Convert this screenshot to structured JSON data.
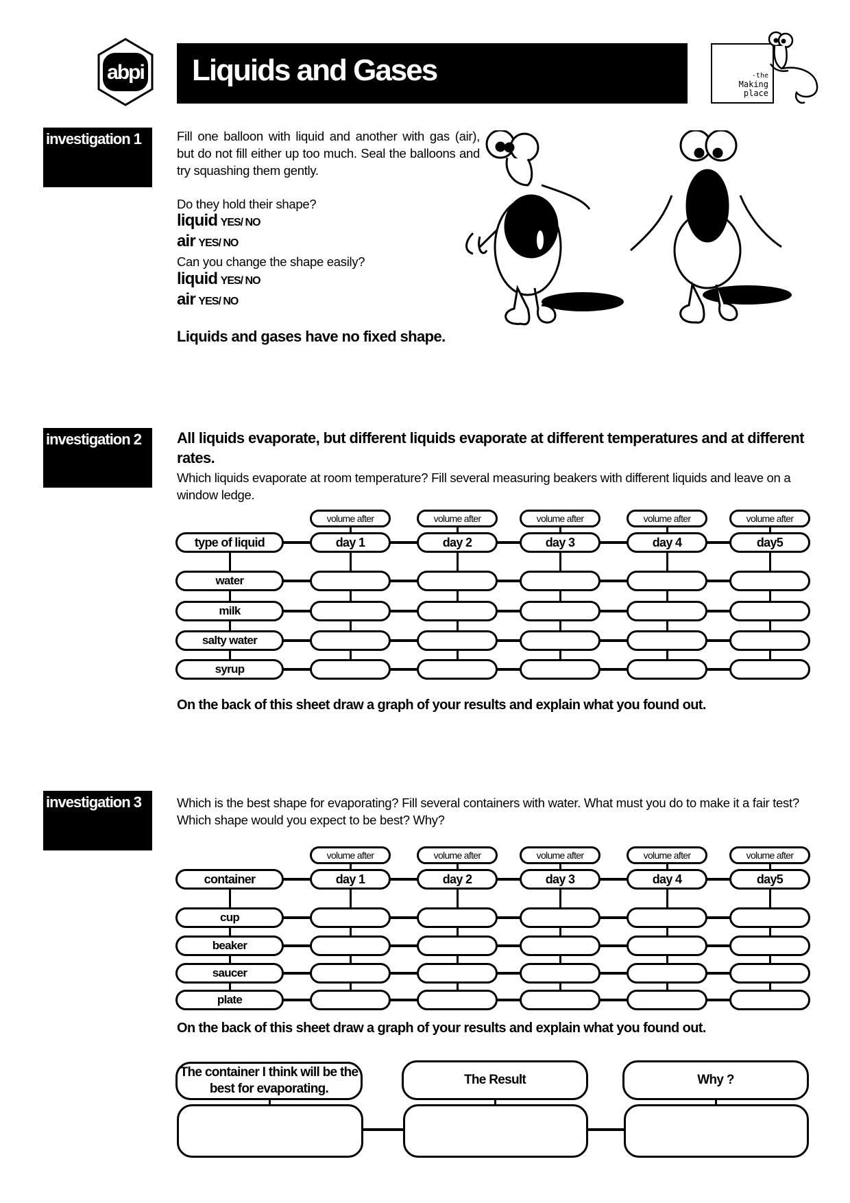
{
  "header": {
    "logo_text": "abpi",
    "title": "Liquids and Gases",
    "partner_logo": {
      "line1": "-the",
      "line2": "Making",
      "line3": "place"
    }
  },
  "investigation1": {
    "label": "investigation 1",
    "intro": "Fill one balloon with liquid and another with gas (air), but do not fill either up too much. Seal the balloons and try squashing them gently.",
    "q1": "Do they hold their shape?",
    "q2": "Can you change the shape easily?",
    "rows": [
      {
        "label": "liquid",
        "choice": "YES/ NO"
      },
      {
        "label": "air",
        "choice": "YES/ NO"
      },
      {
        "label": "liquid",
        "choice": "YES/ NO"
      },
      {
        "label": "air",
        "choice": "YES/ NO"
      }
    ],
    "conclusion": "Liquids and gases have no fixed shape."
  },
  "investigation2": {
    "label": "investigation 2",
    "headline": "All liquids evaporate, but different liquids evaporate at different temperatures and at different rates.",
    "intro": "Which liquids evaporate at room temperature? Fill several measuring beakers with different liquids and leave on a window ledge.",
    "table": {
      "corner": "type of liquid",
      "volume_label": "volume after",
      "days": [
        "day 1",
        "day 2",
        "day 3",
        "day 4",
        "day5"
      ],
      "rows": [
        "water",
        "milk",
        "salty water",
        "syrup"
      ]
    },
    "footer": "On the back of this sheet draw a graph of your results and explain what you found out."
  },
  "investigation3": {
    "label": "investigation 3",
    "intro": "Which is the best shape for evaporating? Fill several containers with water.  What must you do to make it a fair test? Which shape would you expect to be best? Why?",
    "table": {
      "corner": "container",
      "volume_label": "volume after",
      "days": [
        "day 1",
        "day 2",
        "day 3",
        "day 4",
        "day5"
      ],
      "rows": [
        "cup",
        "beaker",
        "saucer",
        "plate"
      ]
    },
    "footer": "On the back of this sheet draw a graph of your results and explain what you found out.",
    "boxes": [
      "The container I think will be the best for evaporating.",
      "The Result",
      "Why ?"
    ]
  }
}
